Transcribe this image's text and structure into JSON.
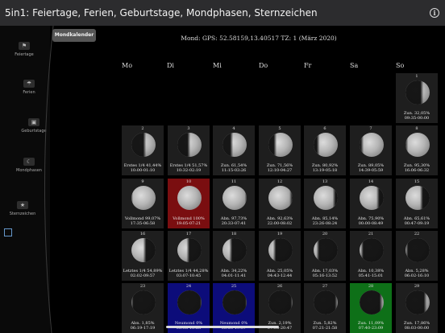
{
  "app": {
    "title": "5in1: Feiertage, Ferien, Geburtstage, Mondphasen, Sternzeichen",
    "info_icon": "i"
  },
  "sidebar": {
    "items": [
      {
        "label": "Feiertage",
        "icon": "flag-icon"
      },
      {
        "label": "Ferien",
        "icon": "umbrella-icon"
      },
      {
        "label": "Geburtstage",
        "icon": "gift-icon"
      },
      {
        "label": "Mondphasen",
        "icon": "moon-icon"
      },
      {
        "label": "Sternzeichen",
        "icon": "star-icon"
      }
    ]
  },
  "tab": {
    "label": "Mondkalender"
  },
  "location": {
    "text": "Mond: GPS: 52.58159,13.40517 TZ: 1 (März 2020)"
  },
  "weekdays": [
    "Mo",
    "Di",
    "Mi",
    "Do",
    "Fr",
    "Sa",
    "So"
  ],
  "days": [
    {
      "day": "1",
      "l1": "Zun. 32,05%",
      "l2": "09:35-00:00",
      "phase": 0.32,
      "waxing": true,
      "hl": ""
    },
    {
      "day": "2",
      "l1": "Erstes 1/4 41,44%",
      "l2": "10:00-01:10",
      "phase": 0.45,
      "waxing": true,
      "hl": ""
    },
    {
      "day": "3",
      "l1": "Erstes 1/4 51,57%",
      "l2": "10:32-02:19",
      "phase": 0.52,
      "waxing": true,
      "hl": ""
    },
    {
      "day": "4",
      "l1": "Zun. 61,54%",
      "l2": "11:15-03:26",
      "phase": 0.62,
      "waxing": true,
      "hl": ""
    },
    {
      "day": "5",
      "l1": "Zun. 71,56%",
      "l2": "12:10-04:27",
      "phase": 0.72,
      "waxing": true,
      "hl": ""
    },
    {
      "day": "6",
      "l1": "Zun. 80,92%",
      "l2": "13:19-05:18",
      "phase": 0.81,
      "waxing": true,
      "hl": ""
    },
    {
      "day": "7",
      "l1": "Zun. 89,05%",
      "l2": "14:39-05:59",
      "phase": 0.89,
      "waxing": true,
      "hl": ""
    },
    {
      "day": "8",
      "l1": "Zun. 95,30%",
      "l2": "16:06-06:32",
      "phase": 0.95,
      "waxing": true,
      "hl": ""
    },
    {
      "day": "9",
      "l1": "Vollmond 99,07%",
      "l2": "17:35-06:58",
      "phase": 0.99,
      "waxing": true,
      "hl": ""
    },
    {
      "day": "10",
      "l1": "Vollmond 100%",
      "l2": "19:05-07:21",
      "phase": 1.0,
      "waxing": false,
      "hl": "red"
    },
    {
      "day": "11",
      "l1": "Abn. 97,73%",
      "l2": "20:33-07:41",
      "phase": 0.98,
      "waxing": false,
      "hl": ""
    },
    {
      "day": "12",
      "l1": "Abn. 92,63%",
      "l2": "22:00-08:02",
      "phase": 0.93,
      "waxing": false,
      "hl": ""
    },
    {
      "day": "13",
      "l1": "Abn. 85,14%",
      "l2": "23:26-08:24",
      "phase": 0.85,
      "waxing": false,
      "hl": ""
    },
    {
      "day": "14",
      "l1": "Abn. 75,90%",
      "l2": "00:00-08:49",
      "phase": 0.76,
      "waxing": false,
      "hl": ""
    },
    {
      "day": "15",
      "l1": "Abn. 65,61%",
      "l2": "00:47-09:19",
      "phase": 0.66,
      "waxing": false,
      "hl": ""
    },
    {
      "day": "16",
      "l1": "Letztes 1/4 54,89%",
      "l2": "02:02-09:57",
      "phase": 0.55,
      "waxing": false,
      "hl": ""
    },
    {
      "day": "17",
      "l1": "Letztes 1/4 44,28%",
      "l2": "03:07-10:45",
      "phase": 0.44,
      "waxing": false,
      "hl": ""
    },
    {
      "day": "18",
      "l1": "Abn. 34,22%",
      "l2": "04:01-11:41",
      "phase": 0.34,
      "waxing": false,
      "hl": ""
    },
    {
      "day": "19",
      "l1": "Abn. 25,05%",
      "l2": "04:43-12:44",
      "phase": 0.25,
      "waxing": false,
      "hl": ""
    },
    {
      "day": "20",
      "l1": "Abn. 17,03%",
      "l2": "05:16-13:52",
      "phase": 0.17,
      "waxing": false,
      "hl": ""
    },
    {
      "day": "21",
      "l1": "Abn. 10,38%",
      "l2": "05:41-15:01",
      "phase": 0.1,
      "waxing": false,
      "hl": ""
    },
    {
      "day": "22",
      "l1": "Abn. 5,28%",
      "l2": "06:02-16:10",
      "phase": 0.05,
      "waxing": false,
      "hl": ""
    },
    {
      "day": "23",
      "l1": "Abn. 1,85%",
      "l2": "06:19-17:19",
      "phase": 0.02,
      "waxing": false,
      "hl": ""
    },
    {
      "day": "24",
      "l1": "Neumond 0%",
      "l2": "06:35-18:28",
      "phase": 0.0,
      "waxing": true,
      "hl": "blue"
    },
    {
      "day": "25",
      "l1": "Neumond 0%",
      "l2": "06:50-19:37",
      "phase": 0.0,
      "waxing": true,
      "hl": "blue"
    },
    {
      "day": "26",
      "l1": "Zun. 2,19%",
      "l2": "07:05-20:47",
      "phase": 0.02,
      "waxing": true,
      "hl": ""
    },
    {
      "day": "27",
      "l1": "Zun. 5,82%",
      "l2": "07:21-21:58",
      "phase": 0.06,
      "waxing": true,
      "hl": ""
    },
    {
      "day": "28",
      "l1": "Zun. 11,09%",
      "l2": "07:40-23:09",
      "phase": 0.11,
      "waxing": true,
      "hl": "green"
    },
    {
      "day": "29",
      "l1": "Zun. 17,86%",
      "l2": "08:03-00:00",
      "phase": 0.18,
      "waxing": true,
      "hl": ""
    }
  ]
}
